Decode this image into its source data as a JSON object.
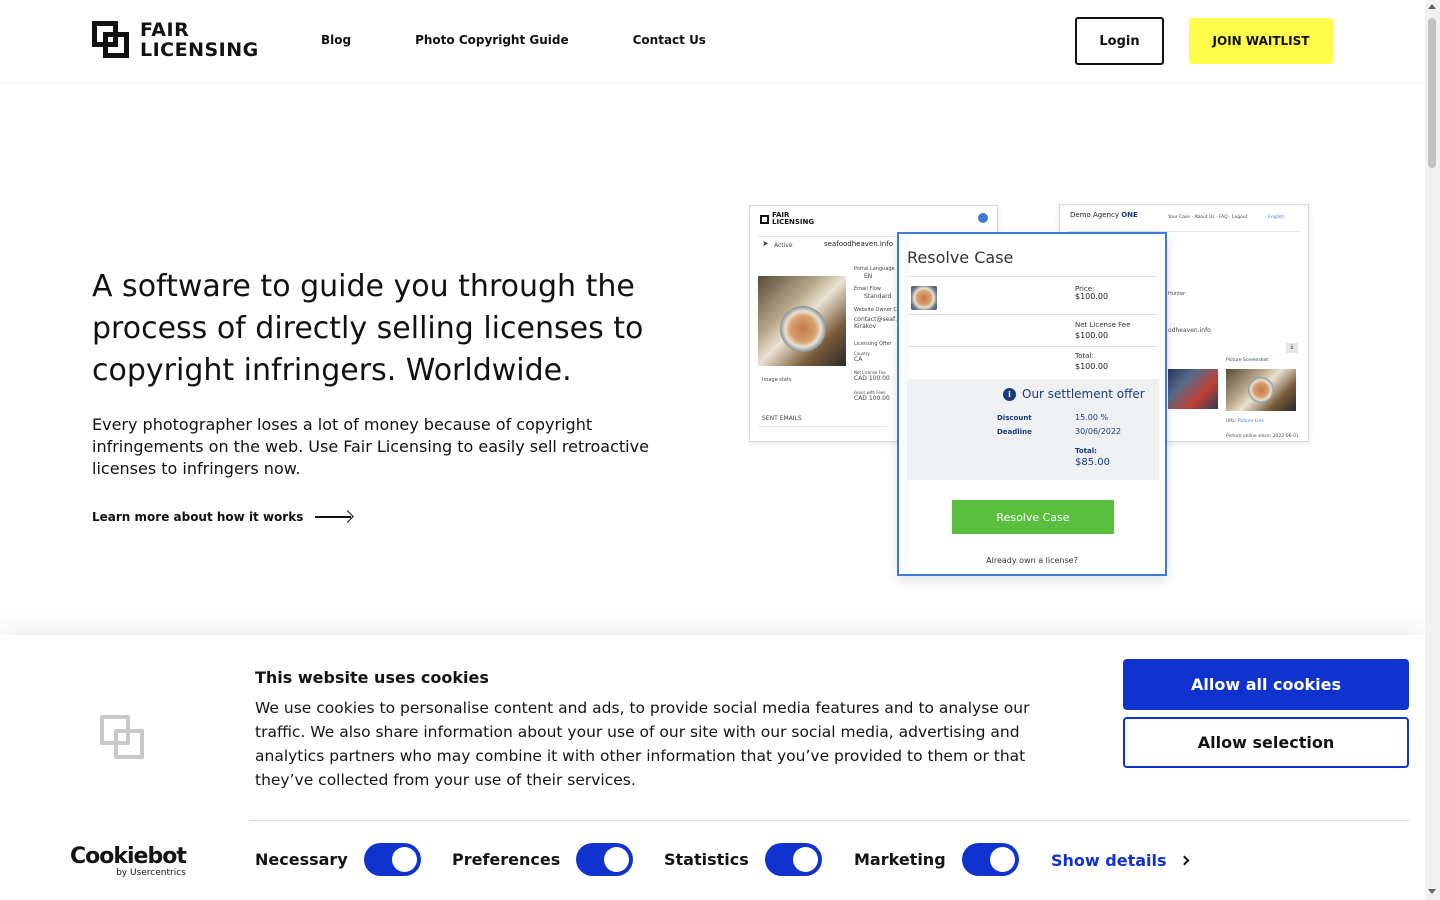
{
  "header": {
    "logo_line1": "FAIR",
    "logo_line2": "LICENSING",
    "nav": [
      "Blog",
      "Photo Copyright Guide",
      "Contact Us"
    ],
    "login_label": "Login",
    "join_label": "JOIN WAITLIST"
  },
  "hero": {
    "title": "A software to guide you through the process of directly selling licenses to copyright infringers. Worldwide.",
    "body": "Every photographer loses a lot of money because of copyright infringements on the web. Use Fair Licensing to easily sell retroactive licenses to infringers now.",
    "learn_more": "Learn more about how it works"
  },
  "mockup": {
    "left": {
      "logo_line1": "FAIR",
      "logo_line2": "LICENSING",
      "status": "Active",
      "domain": "seafoodheaven.info",
      "portal_language_label": "Portal Language",
      "portal_language": "EN",
      "email_flow_label": "Email Flow",
      "email_flow": "Standard",
      "owner_label": "Website Owner Contact",
      "owner_value": "contact@seaf…",
      "owner_name": "Kirakov",
      "licensing_offer_label": "Licensing Offer",
      "country_label": "Country",
      "country": "CA",
      "net_fee_label": "Net License Fee",
      "net_fee": "CAD 100.00",
      "gross_fee_label": "Gross with Fees",
      "gross_fee": "CAD 100.00",
      "image_label": "Image stats",
      "sent_emails": "SENT EMAILS"
    },
    "center": {
      "title": "Resolve Case",
      "price_label": "Price:",
      "price": "$100.00",
      "net_fee_label": "Net License Fee",
      "net_fee": "$100.00",
      "total_label": "Total:",
      "total": "$100.00",
      "settlement_title": "Our settlement offer",
      "discount_label": "Discount",
      "discount": "15.00 %",
      "deadline_label": "Deadline",
      "deadline": "30/06/2022",
      "settle_total_label": "Total:",
      "settle_total": "$85.00",
      "button": "Resolve Case",
      "footer": "Already own a license?"
    },
    "right": {
      "brand_prefix": "Demo Agency",
      "brand_suffix": "ONE",
      "nav": "Your Case · About Us · FAQ · Logout",
      "lang": "English",
      "domain_partial": "odheaven.info",
      "creator_partial": "Hunter",
      "screenshot_label": "Picture Screenshot",
      "url_label": "URL:",
      "url_link": "Picture Link",
      "online_since": "Picture online since: 2022-06-01"
    }
  },
  "cookie": {
    "title": "This website uses cookies",
    "text": "We use cookies to personalise content and ads, to provide social media features and to analyse our traffic. We also share information about your use of our site with our social media, advertising and analytics partners who may combine it with other information that you’ve provided to them or that they’ve collected from your use of their services.",
    "allow_all": "Allow all cookies",
    "allow_selection": "Allow selection",
    "brand": "Cookiebot",
    "brand_by": "by Usercentrics",
    "toggles": [
      {
        "label": "Necessary",
        "on": true
      },
      {
        "label": "Preferences",
        "on": true
      },
      {
        "label": "Statistics",
        "on": true
      },
      {
        "label": "Marketing",
        "on": true
      }
    ],
    "show_details": "Show details"
  },
  "colors": {
    "accent_yellow": "#fffc4b",
    "cookie_blue": "#1032cf",
    "resolve_green": "#5abf3f",
    "settlement_navy": "#1a3a7a"
  }
}
